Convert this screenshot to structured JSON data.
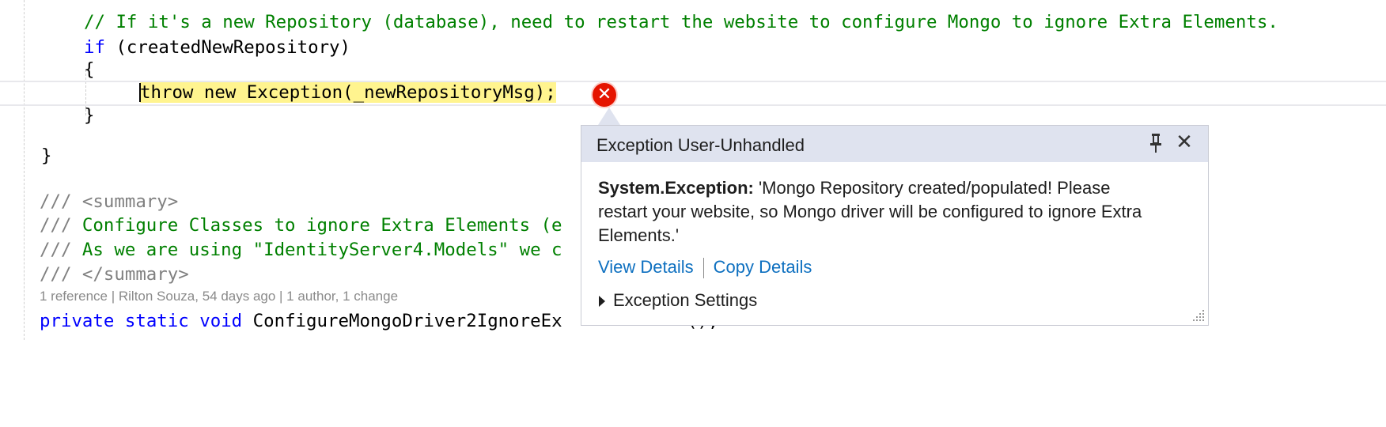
{
  "code": {
    "line1_comment": "// If it's a new Repository (database), need to restart the website to configure Mongo to ignore Extra Elements.",
    "line2_keyword": "if",
    "line2_rest": " (createdNewRepository)",
    "line3": "{",
    "line4_statement": "throw new Exception(_newRepositoryMsg);",
    "line5": "}",
    "line6": "}",
    "doc1": "/// <summary>",
    "doc2_prefix": "/// ",
    "doc2_text": "Configure Classes to ignore Extra Elements (e",
    "doc3_prefix": "/// ",
    "doc3_text": "As we are using \"IdentityServer4.Models\" we c",
    "doc4": "/// </summary>",
    "codelens": "1 reference | Rilton Souza, 54 days ago | 1 author, 1 change",
    "decl_kw1": "private",
    "decl_kw2": "static",
    "decl_kw3": "void",
    "decl_name": " ConfigureMongoDriver2IgnoreEx",
    "decl_tail": "();"
  },
  "exception_popup": {
    "title": "Exception User-Unhandled",
    "exception_type": "System.Exception:",
    "message_line1": " 'Mongo Repository created/populated! Please",
    "message_line2": "restart your website, so Mongo driver will be configured  to ignore Extra",
    "message_line3": "Elements.'",
    "view_details": "View Details",
    "copy_details": "Copy Details",
    "exception_settings": "Exception Settings"
  },
  "colors": {
    "keyword": "#0000ff",
    "comment": "#008000",
    "link": "#0e70c0",
    "error": "#e51400",
    "statement_highlight": "#fff48f",
    "popup_header": "#dfe3ef"
  },
  "icons": {
    "error": "error-x-icon",
    "pin": "pin-icon",
    "close": "close-icon",
    "expand": "triangle-right-icon",
    "resize": "resize-grip-icon"
  }
}
